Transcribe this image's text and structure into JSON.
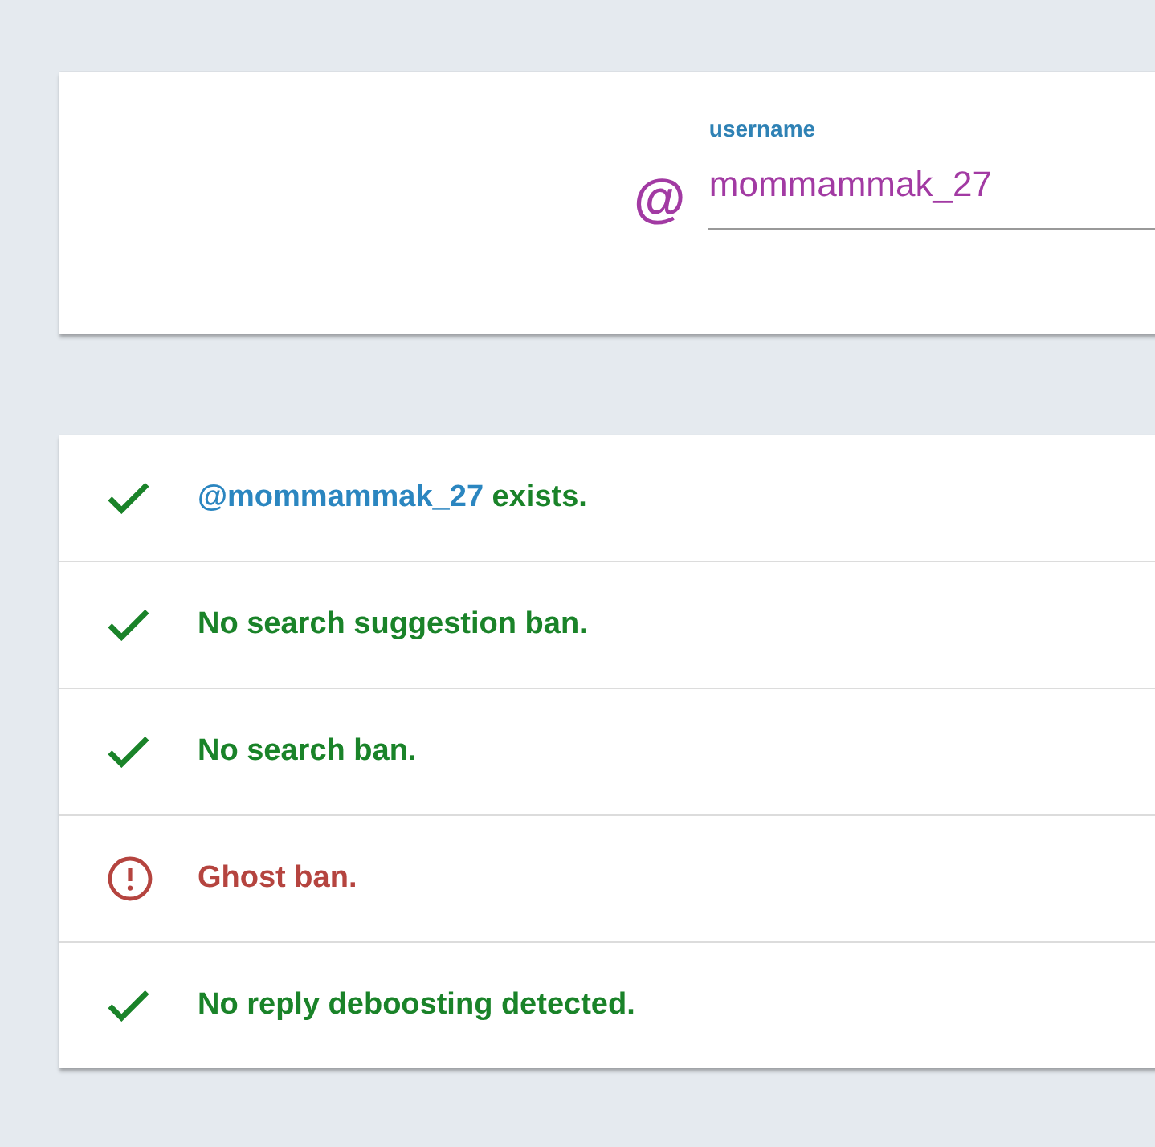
{
  "username_field": {
    "label": "username",
    "prefix": "@",
    "value": "mommammak_27"
  },
  "results": [
    {
      "kind": "pass",
      "handle": "@mommammak_27",
      "text": "exists."
    },
    {
      "kind": "pass",
      "text": "No search suggestion ban."
    },
    {
      "kind": "pass",
      "text": "No search ban."
    },
    {
      "kind": "fail",
      "text": "Ghost ban."
    },
    {
      "kind": "pass",
      "text": "No reply deboosting detected."
    }
  ]
}
